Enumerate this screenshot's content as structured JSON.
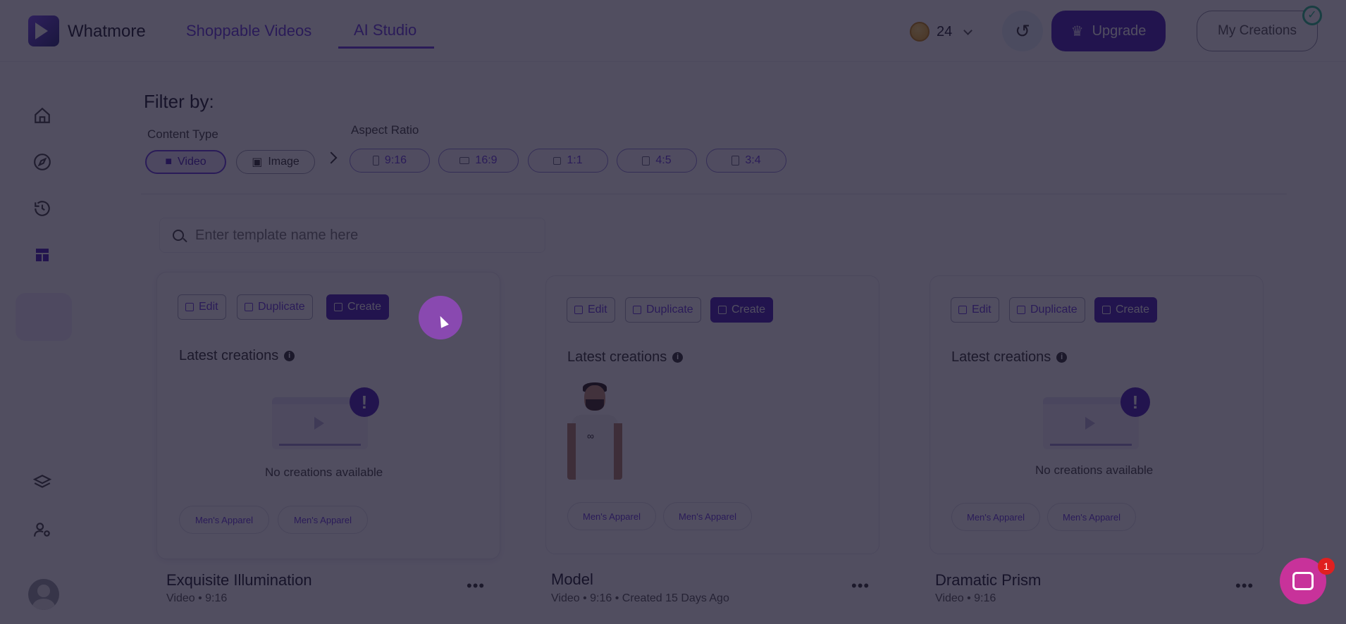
{
  "header": {
    "brand": "Whatmore",
    "tabs": [
      {
        "label": "Shoppable Videos"
      },
      {
        "label": "AI Studio",
        "active": true
      }
    ],
    "credits": "24",
    "upgrade_label": "Upgrade",
    "my_creations_label": "My Creations"
  },
  "sidebar": {
    "items": [
      {
        "icon": "home-icon"
      },
      {
        "icon": "compass-icon"
      },
      {
        "icon": "history-icon"
      },
      {
        "icon": "templates-icon",
        "active": true
      },
      {
        "icon": "layers-icon"
      },
      {
        "icon": "user-settings-icon"
      }
    ]
  },
  "filter": {
    "title": "Filter by:",
    "content_type_label": "Content Type",
    "content_types": [
      {
        "label": "Video",
        "active": true
      },
      {
        "label": "Image"
      }
    ],
    "aspect_ratio_label": "Aspect Ratio",
    "aspect_ratios": [
      "9:16",
      "16:9",
      "1:1",
      "4:5",
      "3:4"
    ]
  },
  "search": {
    "placeholder": "Enter template name here"
  },
  "card_actions": {
    "edit": "Edit",
    "duplicate": "Duplicate",
    "create": "Create"
  },
  "latest_creations_label": "Latest creations",
  "cards": [
    {
      "title": "Exquisite Illumination",
      "meta": "Video • 9:16",
      "empty_text": "No creations available",
      "tags": [
        "Men's Apparel",
        "Men's Apparel"
      ]
    },
    {
      "title": "Model",
      "meta": "Video • 9:16 • Created 15 Days Ago",
      "tags": [
        "Men's Apparel",
        "Men's Apparel"
      ]
    },
    {
      "title": "Dramatic Prism",
      "meta": "Video • 9:16",
      "empty_text": "No creations available",
      "tags": [
        "Men's Apparel",
        "Men's Apparel"
      ]
    }
  ],
  "chat": {
    "badge": "1"
  },
  "colors": {
    "accent": "#6a3de0",
    "primary": "#4a1fb8",
    "overlay": "#14102a"
  }
}
